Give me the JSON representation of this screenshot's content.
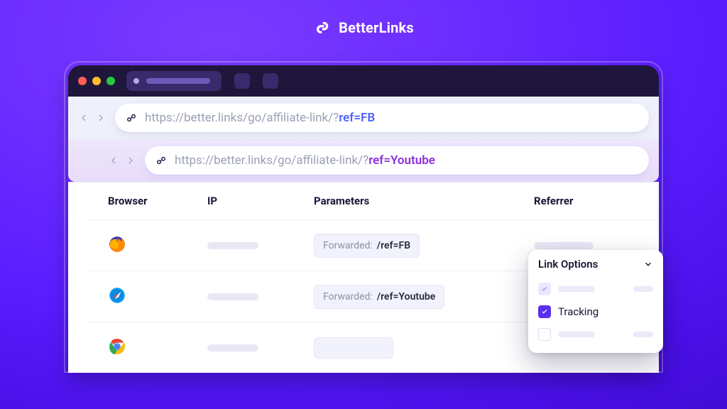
{
  "brand": {
    "name": "BetterLinks"
  },
  "urls": {
    "primary_base": "https://better.links/go/affiliate-link/?",
    "primary_highlight": "ref=FB",
    "secondary_base": "https://better.links/go/affiliate-link/?",
    "secondary_highlight": "ref=Youtube"
  },
  "table": {
    "headers": {
      "browser": "Browser",
      "ip": "IP",
      "params": "Parameters",
      "referrer": "Referrer"
    },
    "rows": [
      {
        "browser": "firefox",
        "param_prefix": "Forwarded: ",
        "param_value": "/ref=FB"
      },
      {
        "browser": "safari",
        "param_prefix": "Forwarded: ",
        "param_value": "/ref=Youtube"
      },
      {
        "browser": "chrome",
        "param_prefix": "",
        "param_value": ""
      }
    ]
  },
  "popover": {
    "title": "Link Options",
    "tracking_label": "Tracking"
  }
}
